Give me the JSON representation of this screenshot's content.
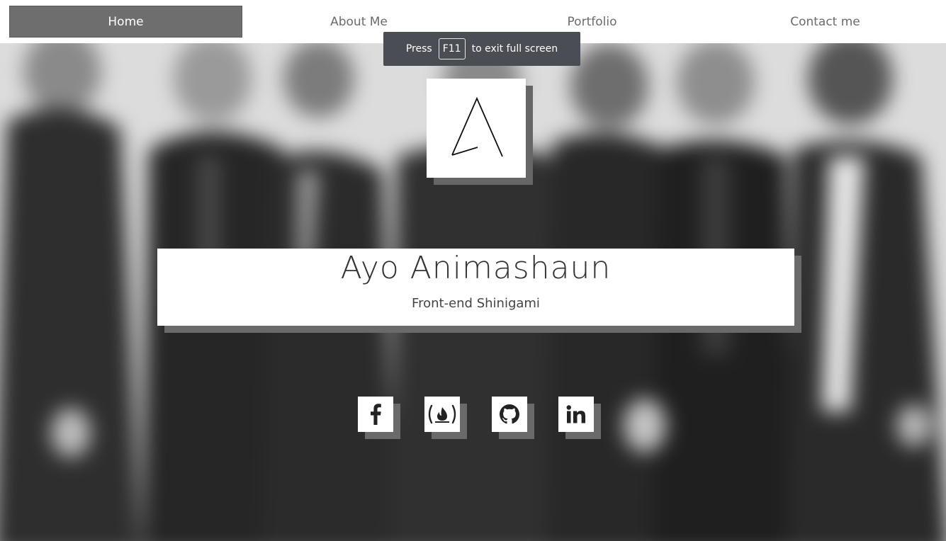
{
  "nav": {
    "items": [
      {
        "label": "Home",
        "active": true
      },
      {
        "label": "About Me",
        "active": false
      },
      {
        "label": "Portfolio",
        "active": false
      },
      {
        "label": "Contact me",
        "active": false
      }
    ]
  },
  "toast": {
    "before": "Press",
    "key": "F11",
    "after": "to exit full screen"
  },
  "hero": {
    "name": "Ayo Animashaun",
    "tagline": "Front-end Shinigami"
  },
  "social": [
    {
      "icon": "facebook-icon"
    },
    {
      "icon": "freecodecamp-icon"
    },
    {
      "icon": "github-icon"
    },
    {
      "icon": "linkedin-icon"
    }
  ],
  "colors": {
    "nav_active_bg": "#6e6e6e",
    "card_shadow": "#6a6a6a",
    "text_dark": "#333333",
    "toast_bg": "#4a4d54"
  }
}
